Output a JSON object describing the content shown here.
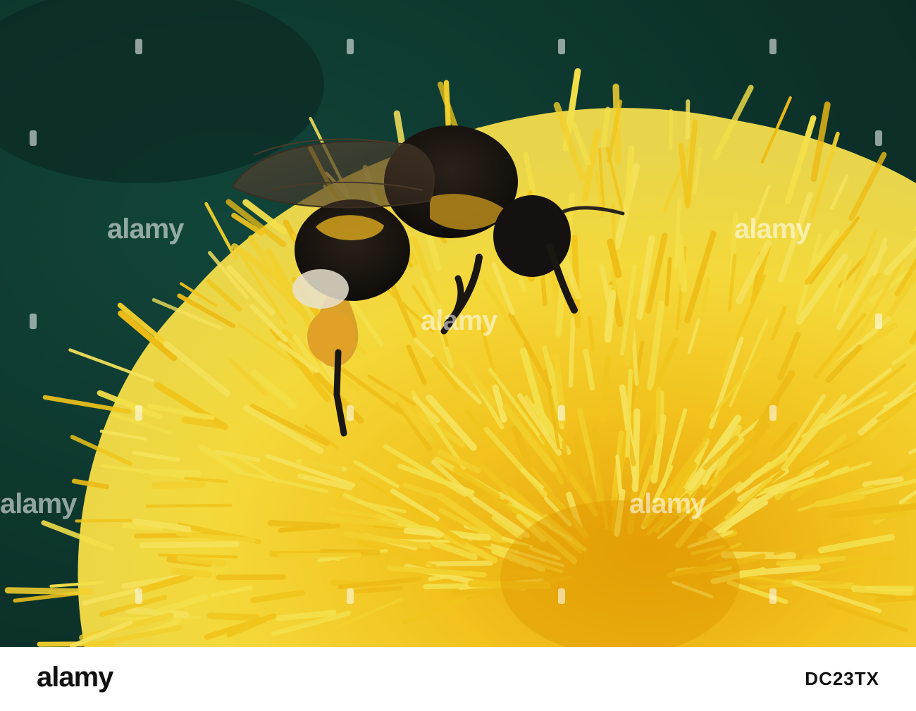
{
  "photo": {
    "subject": "bumblebee-on-yellow-flower",
    "colors": {
      "background": "#0f3a31",
      "flower_light": "#f4e04a",
      "flower_mid": "#f1c51b",
      "flower_deep": "#e09a00",
      "bee_dark": "#1a1612",
      "bee_band": "#c99a1e"
    }
  },
  "watermark": {
    "text": "alamy"
  },
  "footer": {
    "logo_text": "alamy",
    "image_id": "DC23TX"
  }
}
